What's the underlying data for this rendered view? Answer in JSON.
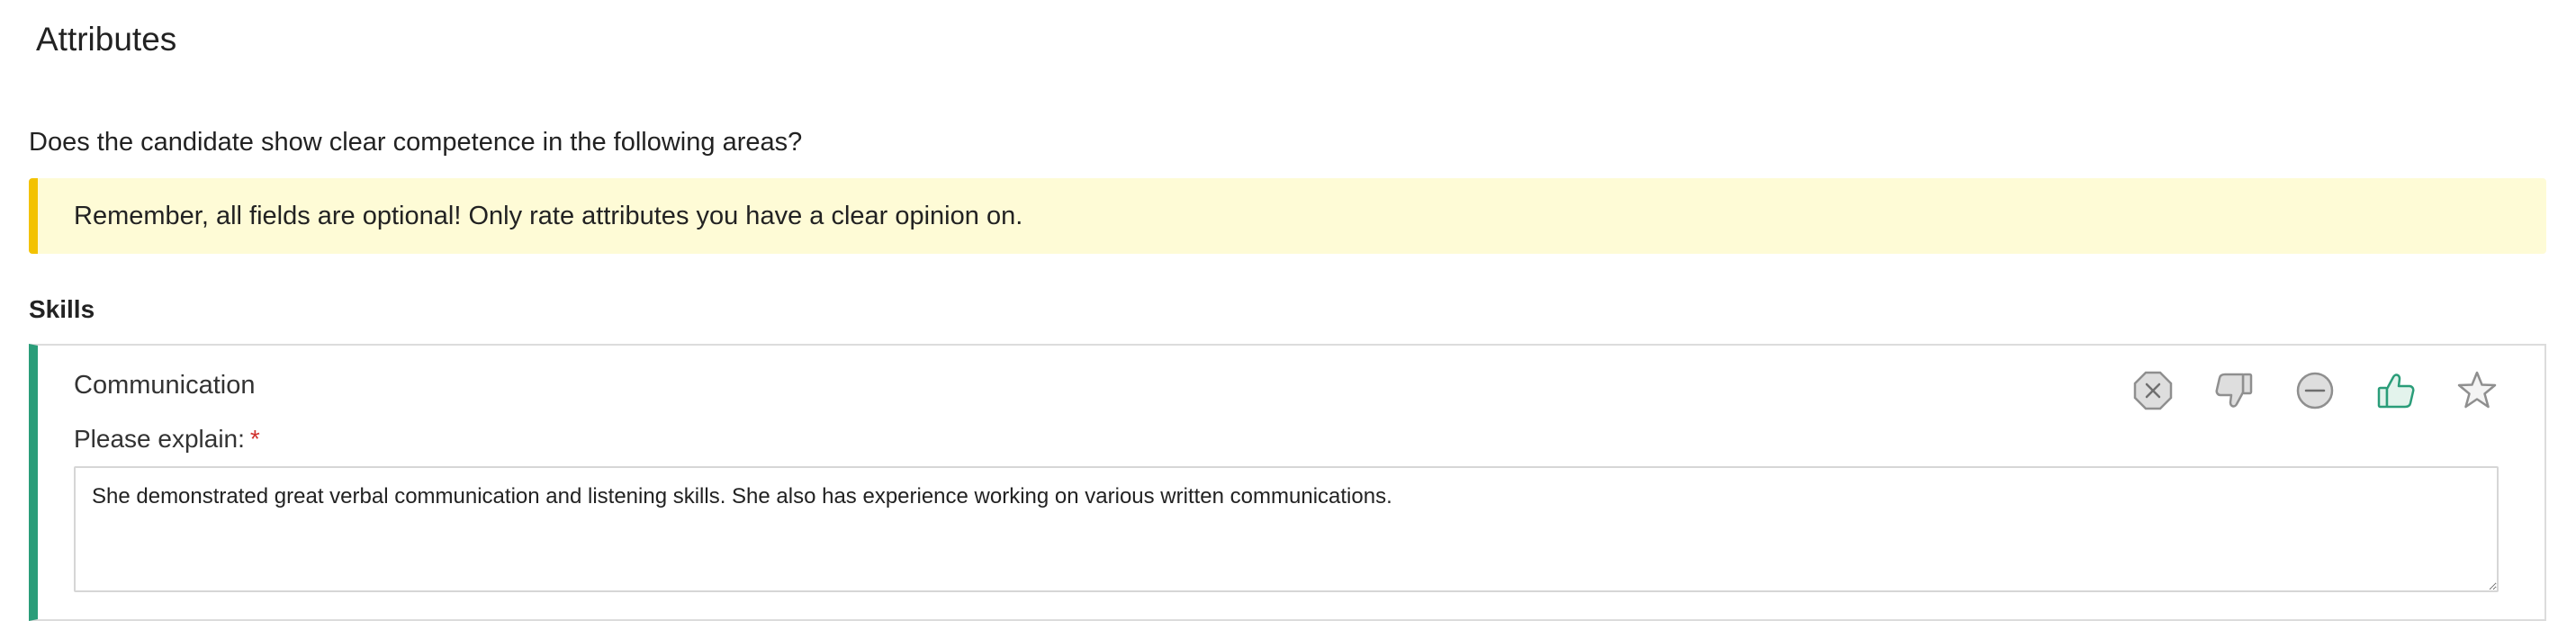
{
  "page": {
    "title": "Attributes",
    "question": "Does the candidate show clear competence in the following areas?"
  },
  "notice": {
    "text": "Remember, all fields are optional! Only rate attributes you have a clear opinion on.",
    "accent_color": "#f3c200",
    "background_color": "#fefbd6"
  },
  "section": {
    "heading": "Skills"
  },
  "attribute": {
    "name": "Communication",
    "accent_color": "#2a9d79",
    "ratings": [
      {
        "icon": "no-rating-icon",
        "selected": false
      },
      {
        "icon": "thumbs-down-icon",
        "selected": false
      },
      {
        "icon": "neutral-icon",
        "selected": false
      },
      {
        "icon": "thumbs-up-icon",
        "selected": true
      },
      {
        "icon": "star-icon",
        "selected": false
      }
    ],
    "selected_color": "#2a9d79",
    "explain": {
      "label": "Please explain:",
      "required_marker": "*",
      "value": "She demonstrated great verbal communication and listening skills. She also has experience working on various written communications."
    }
  }
}
